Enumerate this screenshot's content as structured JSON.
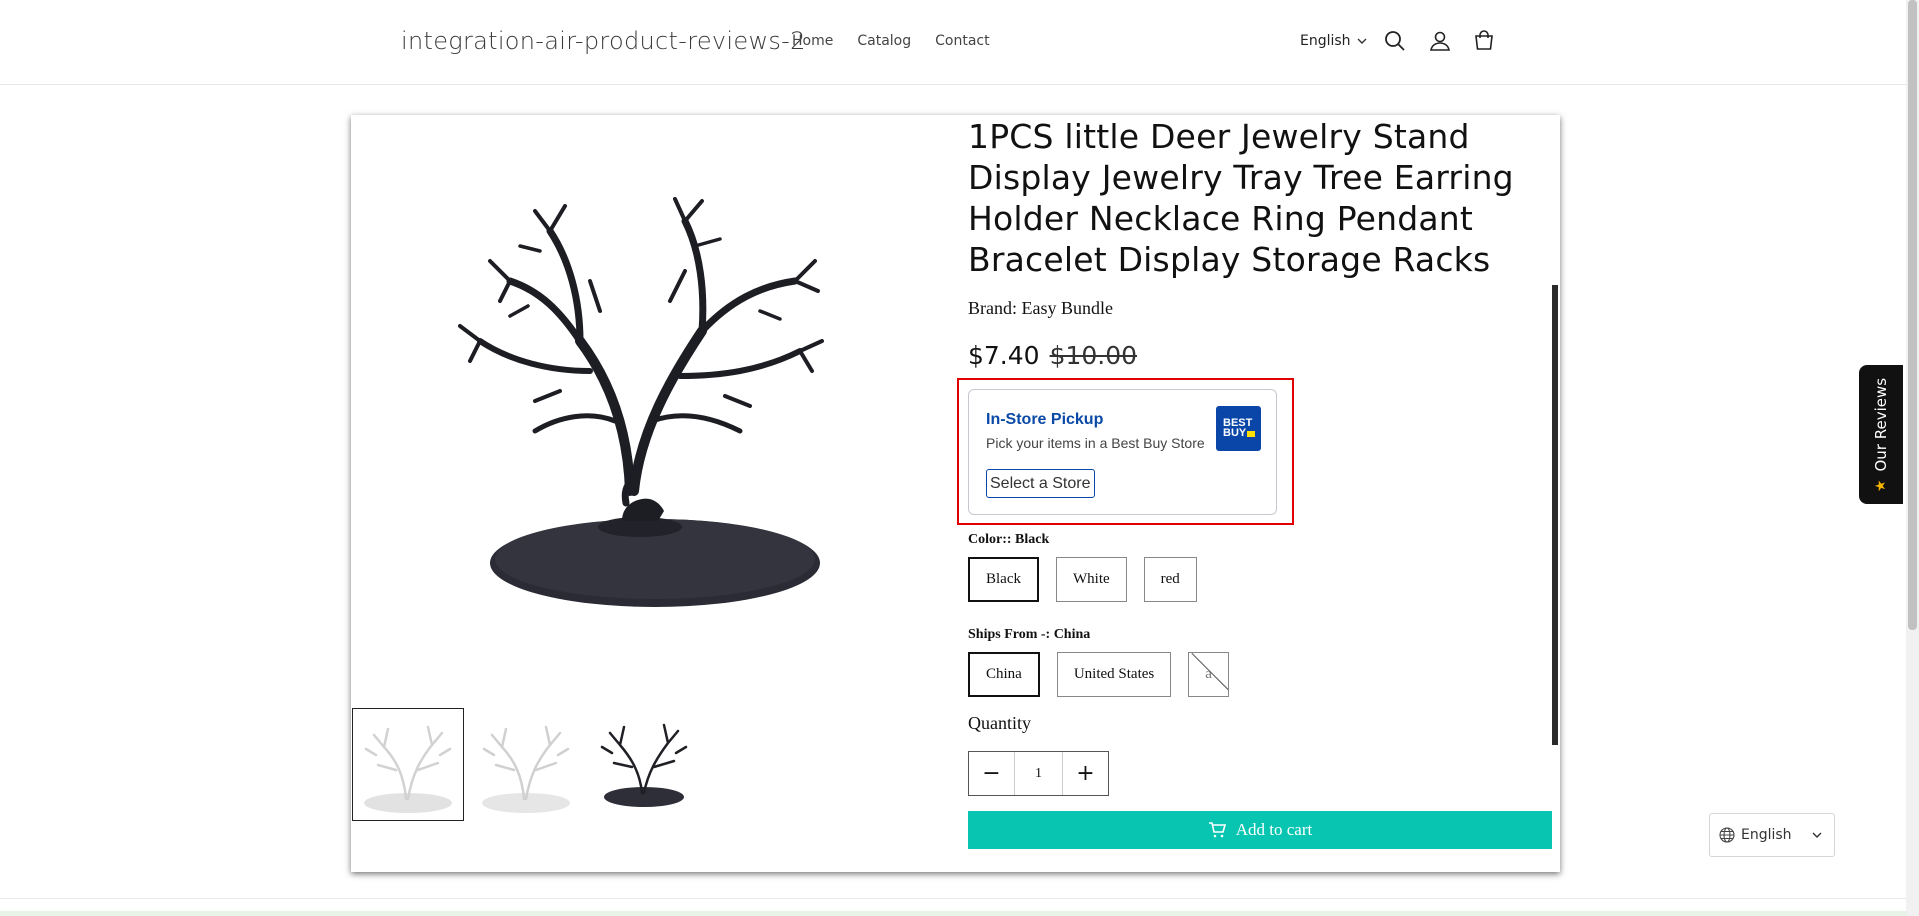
{
  "header": {
    "store_name": "integration-air-product-reviews-2",
    "nav": [
      {
        "label": "Home"
      },
      {
        "label": "Catalog"
      },
      {
        "label": "Contact"
      }
    ],
    "language": "English",
    "icons": [
      "search-icon",
      "account-icon",
      "cart-icon"
    ]
  },
  "product": {
    "title": "1PCS little Deer Jewelry Stand Display Jewelry Tray Tree Earring Holder Necklace Ring Pendant Bracelet Display Storage Racks",
    "brand": "Brand: Easy Bundle",
    "price": "$7.40",
    "compare_price": "$10.00",
    "main_image_color": "black",
    "thumbnails": [
      {
        "variant": "white",
        "selected": true
      },
      {
        "variant": "white",
        "selected": false
      },
      {
        "variant": "black",
        "selected": false
      }
    ]
  },
  "pickup": {
    "title": "In-Store Pickup",
    "subtitle": "Pick your items in a Best Buy Store",
    "logo_text_1": "BEST",
    "logo_text_2": "BUY",
    "button": "Select a Store",
    "highlighted": true
  },
  "options": {
    "color": {
      "label": "Color:: Black",
      "values": [
        {
          "label": "Black",
          "selected": true,
          "disabled": false
        },
        {
          "label": "White",
          "selected": false,
          "disabled": false
        },
        {
          "label": "red",
          "selected": false,
          "disabled": false
        }
      ]
    },
    "ships_from": {
      "label": "Ships From -: China",
      "values": [
        {
          "label": "China",
          "selected": true,
          "disabled": false
        },
        {
          "label": "United States",
          "selected": false,
          "disabled": false
        },
        {
          "label": "a",
          "selected": false,
          "disabled": true
        }
      ]
    }
  },
  "quantity": {
    "label": "Quantity",
    "value": "1",
    "minus": "−",
    "plus": "+"
  },
  "cart": {
    "button": "Add to cart"
  },
  "widgets": {
    "reviews_tab": "Our Reviews",
    "language": "English"
  },
  "colors": {
    "accent_teal": "#08c5b1",
    "bestbuy_blue": "#0a46a8",
    "highlight_red": "#e00000"
  }
}
